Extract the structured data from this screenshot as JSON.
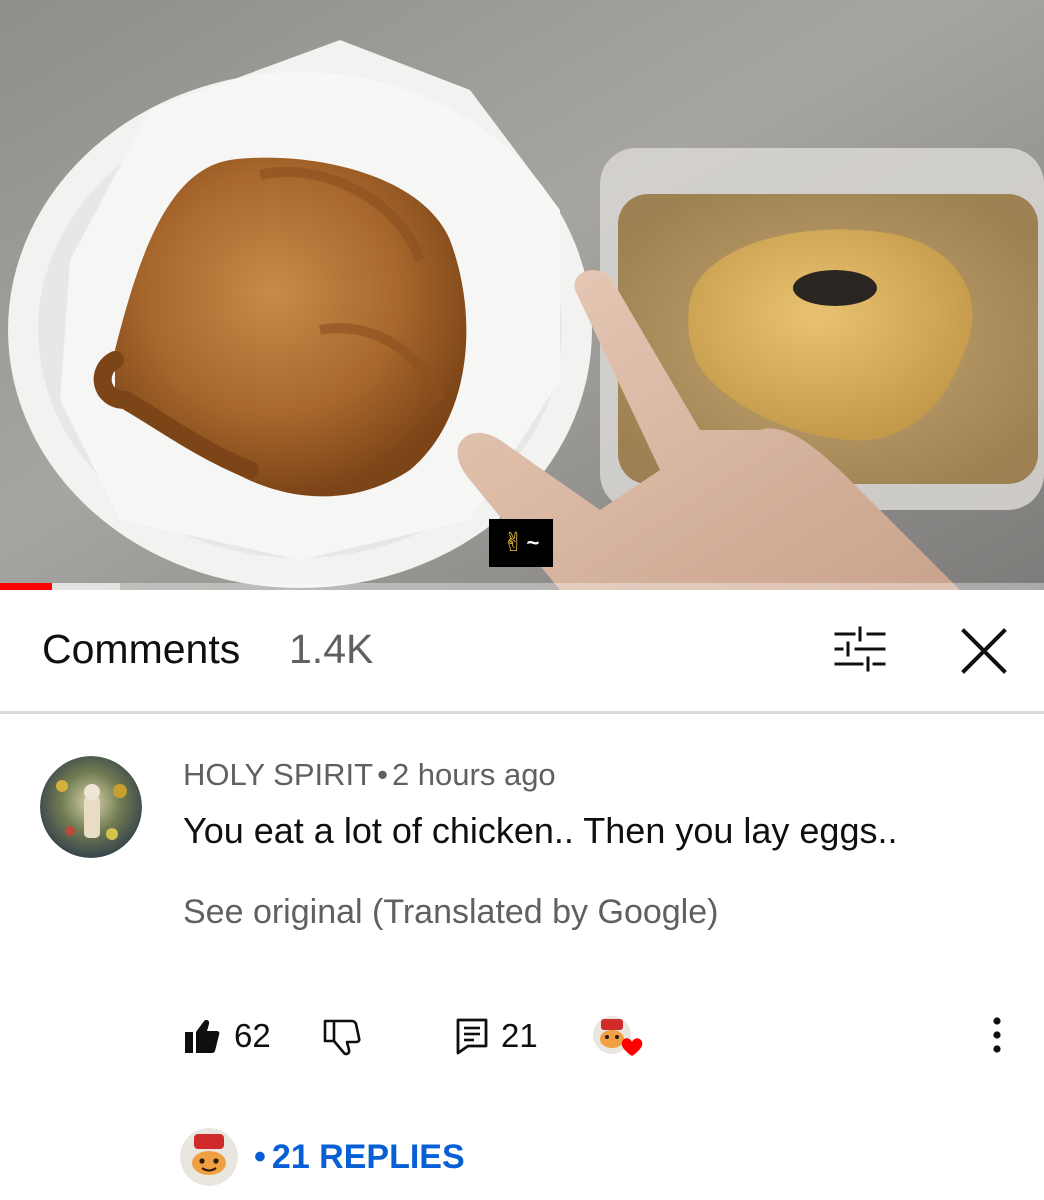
{
  "video": {
    "caption_icon": "victory-hand-icon",
    "caption_text": "✌",
    "caption_suffix": "~",
    "progress": 0.05,
    "buffered": 0.115
  },
  "comments": {
    "title": "Comments",
    "count": "1.4K",
    "filter_icon": "sliders-icon",
    "close_icon": "close-icon"
  },
  "comment": {
    "author": "HOLY SPIRIT",
    "separator": "•",
    "time": "2 hours ago",
    "text": "You eat a lot of chicken.. Then you lay eggs..",
    "see_original": "See original (Translated by Google)",
    "likes": "62",
    "replies_count": "21",
    "like_icon": "thumbs-up-filled-icon",
    "dislike_icon": "thumbs-down-icon",
    "reply_icon": "comment-icon",
    "more_icon": "more-vertical-icon"
  },
  "replies": {
    "separator": "•",
    "label": "21 REPLIES",
    "color": "#065fd4"
  },
  "colors": {
    "progress": "#ff0000",
    "link": "#065fd4",
    "heart": "#ff0000",
    "secondary_text": "#606060"
  }
}
